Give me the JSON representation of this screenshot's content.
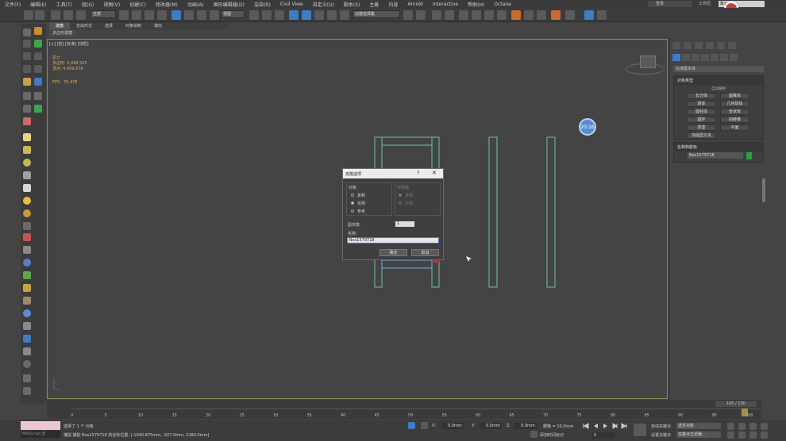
{
  "menu": {
    "items": [
      "文件(F)",
      "编辑(E)",
      "工具(T)",
      "组(G)",
      "视图(V)",
      "创建(C)",
      "修改器(M)",
      "动画(A)",
      "图形编辑器(D)",
      "渲染(R)",
      "Civil View",
      "自定义(U)",
      "脚本(S)",
      "主着",
      "内容",
      "Arnold",
      "Interactive",
      "帮助(H)",
      "Octane"
    ],
    "login": "登录",
    "workspace_label": "工作区:",
    "workspace_value": "默认"
  },
  "toolbar": {
    "filter": "全部",
    "view": "视图",
    "selection_set": "创建选择集"
  },
  "ribbon": {
    "tabs": [
      "建模",
      "自由形式",
      "选择",
      "对象绘制",
      "填充"
    ],
    "active": "建模",
    "subtab": "多边形建模"
  },
  "viewport": {
    "label": "[+] [前] [标准] [线框]",
    "stats_title": "总计",
    "polys_label": "多边形:",
    "polys_value": "5,098,505",
    "verts_label": "顶点:",
    "verts_value": "4,409,678",
    "fps_label": "FPS:",
    "fps_value": "70.478",
    "timer": "20:16"
  },
  "dialog": {
    "title": "克隆选项",
    "help": "?",
    "close": "✕",
    "object_group": "对象",
    "controller_group": "控制器",
    "obj_options": [
      "复制",
      "实例",
      "参考"
    ],
    "obj_selected": 1,
    "ctrl_options": [
      "复制",
      "实例"
    ],
    "ctrl_selected": 0,
    "copies_label": "副本数:",
    "copies_value": "1",
    "name_label": "名称:",
    "name_value": "Box1579718",
    "ok": "确定",
    "cancel": "取消"
  },
  "rightpanel": {
    "category": "标准基本体",
    "object_type_header": "对象类型",
    "autogrid": "自动栅格",
    "buttons": [
      "长方体",
      "圆锥体",
      "球体",
      "几何球体",
      "圆柱体",
      "管状体",
      "圆环",
      "四棱锥",
      "茶壶",
      "平面",
      "加强型文本"
    ],
    "name_color_header": "名称和颜色",
    "object_name": "Box1579718",
    "swatch_color": "#1fa83a"
  },
  "timeline": {
    "frame_display": "100 / 100",
    "ticks": [
      "0",
      "5",
      "10",
      "15",
      "20",
      "25",
      "30",
      "35",
      "40",
      "45",
      "50",
      "55",
      "60",
      "65",
      "70",
      "75",
      "80",
      "85",
      "90",
      "95",
      "100"
    ]
  },
  "status": {
    "maxscript": "MAXScript 迷",
    "selected": "选择了 1 个 对象",
    "prompt": "捕捉 捕捉 Box1579718 的坐标位置: [-1940.875mm, -927.0mm, 2280.0mm]",
    "x_label": "X:",
    "x_value": "0.0mm",
    "y_label": "Y:",
    "y_value": "0.0mm",
    "z_label": "Z:",
    "z_value": "0.0mm",
    "grid": "栅格 = 10.0mm",
    "add_time_tag": "添加时间标记",
    "autokey": "自动关键点",
    "selected_obj": "选定对象",
    "set_key": "设置关键点",
    "key_filters": "关键点过滤器...",
    "frame": "0"
  }
}
